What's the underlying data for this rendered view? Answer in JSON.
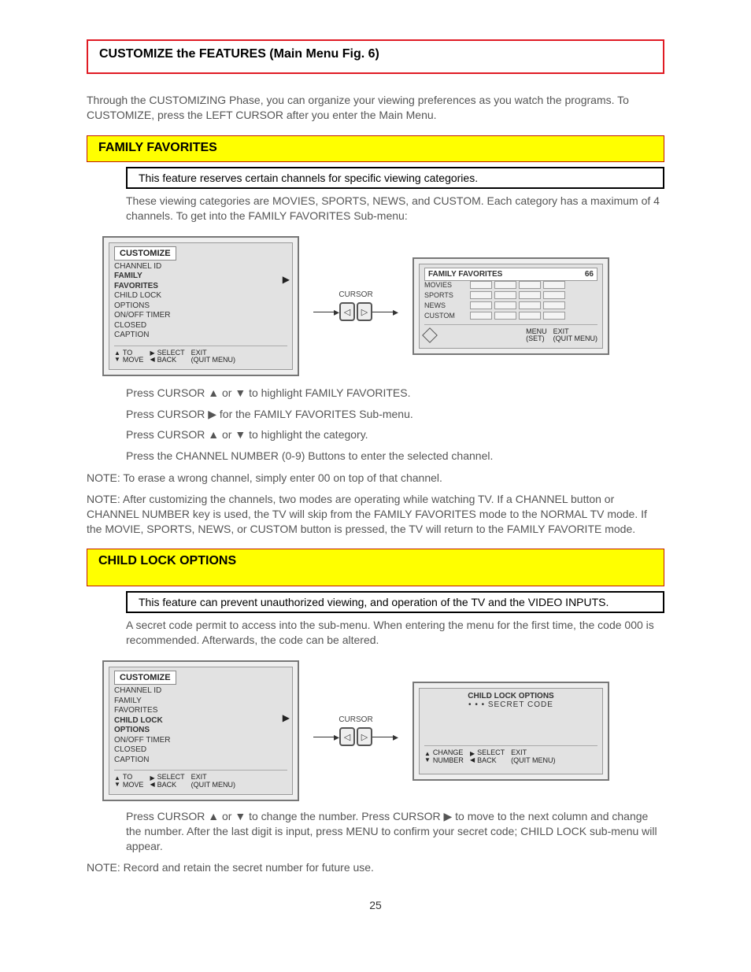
{
  "page_number": "25",
  "red_section_title": "CUSTOMIZE the FEATURES (Main Menu Fig. 6)",
  "intro_text": "Through the CUSTOMIZING Phase, you can organize your viewing preferences as you watch the programs. To CUSTOMIZE, press the LEFT CURSOR after you enter the Main Menu.",
  "family_favorites": {
    "yellow_title": "FAMILY FAVORITES",
    "feature_line": "This feature reserves certain channels for specific viewing categories.",
    "body": "These viewing categories are MOVIES, SPORTS, NEWS, and CUSTOM. Each category has a maximum of 4 channels. To get into the FAMILY FAVORITES Sub-menu:",
    "steps": [
      "Press CURSOR ▲ or ▼ to highlight FAMILY FAVORITES.",
      "Press CURSOR ▶ for the FAMILY FAVORITES Sub-menu.",
      "Press CURSOR ▲ or ▼ to highlight the category.",
      "Press the CHANNEL NUMBER (0-9) Buttons to enter the selected channel."
    ],
    "notes": [
      "NOTE: To erase a wrong channel, simply enter 00 on top of that channel.",
      "NOTE: After customizing the channels, two modes are operating while watching TV. If a CHANNEL button or CHANNEL NUMBER key is used, the TV will skip from the FAMILY FAVORITES mode to the NORMAL TV mode. If the MOVIE, SPORTS, NEWS, or CUSTOM button is pressed, the TV will return to the FAMILY FAVORITE mode."
    ],
    "screen1": {
      "title": "CUSTOMIZE",
      "items": [
        "CHANNEL ID",
        "FAMILY",
        "FAVORITES",
        "CHILD LOCK",
        "OPTIONS",
        "ON/OFF TIMER",
        "CLOSED",
        "CAPTION"
      ],
      "selected": [
        1,
        2
      ],
      "footer": {
        "left1": "TO",
        "left2": "MOVE",
        "mid1": "SELECT",
        "mid2": "BACK",
        "right1": "EXIT",
        "right2": "(QUIT MENU)"
      }
    },
    "cursor_label": "CURSOR",
    "screen2": {
      "title": "FAMILY FAVORITES",
      "num": "66",
      "rows": [
        "MOVIES",
        "SPORTS",
        "NEWS",
        "CUSTOM"
      ],
      "footer": {
        "mid1": "MENU",
        "mid2": "(SET)",
        "right1": "EXIT",
        "right2": "(QUIT MENU)"
      }
    }
  },
  "child_lock": {
    "yellow_title": "CHILD LOCK OPTIONS",
    "feature_line": "This feature can prevent unauthorized viewing, and operation of the TV and the VIDEO INPUTS.",
    "body": "A secret code permit to access into the sub-menu. When entering the menu for the first time, the code 000 is recommended. Afterwards, the code can be altered.",
    "screen1": {
      "title": "CUSTOMIZE",
      "items": [
        "CHANNEL ID",
        "FAMILY",
        "FAVORITES",
        "CHILD LOCK",
        "OPTIONS",
        "ON/OFF TIMER",
        "CLOSED",
        "CAPTION"
      ],
      "selected": [
        3,
        4
      ],
      "footer": {
        "left1": "TO",
        "left2": "MOVE",
        "mid1": "SELECT",
        "mid2": "BACK",
        "right1": "EXIT",
        "right2": "(QUIT MENU)"
      }
    },
    "cursor_label": "CURSOR",
    "screen2": {
      "title": "CHILD LOCK OPTIONS",
      "sub": "• • •   SECRET CODE",
      "footer": {
        "left1": "CHANGE",
        "left2": "NUMBER",
        "mid1": "SELECT",
        "mid2": "BACK",
        "right1": "EXIT",
        "right2": "(QUIT MENU)"
      }
    },
    "after": "Press CURSOR ▲ or ▼ to change the number. Press CURSOR ▶ to move to the next column and change the number. After the last digit is input, press MENU to confirm your secret code; CHILD LOCK sub-menu will appear.",
    "note": "NOTE: Record and retain the secret number for future use."
  }
}
